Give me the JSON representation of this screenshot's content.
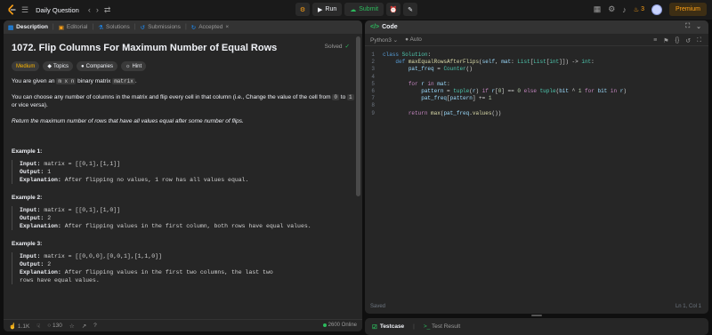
{
  "topbar": {
    "title": "Daily Question",
    "run": "Run",
    "submit": "Submit",
    "streak": "3",
    "premium": "Premium"
  },
  "left_tabs": [
    "Description",
    "Editorial",
    "Solutions",
    "Submissions",
    "Accepted"
  ],
  "problem": {
    "title": "1072. Flip Columns For Maximum Number of Equal Rows",
    "status": "Solved",
    "difficulty": "Medium",
    "pills": [
      "Topics",
      "Companies",
      "Hint"
    ],
    "intro_a": "You are given an ",
    "intro_code1": "m x n",
    "intro_b": " binary matrix ",
    "intro_code2": "matrix",
    "intro_c": ".",
    "p2_a": "You can choose any number of columns in the matrix and flip every cell in that column (i.e., Change the value of the cell from ",
    "p2_code1": "0",
    "p2_b": " to ",
    "p2_code2": "1",
    "p2_c": " or vice versa).",
    "p3": "Return the maximum number of rows that have all values equal after some number of flips.",
    "examples": [
      {
        "heading": "Example 1:",
        "input": "matrix = [[0,1],[1,1]]",
        "output": "1",
        "explanation": "After flipping no values, 1 row has all values equal."
      },
      {
        "heading": "Example 2:",
        "input": "matrix = [[0,1],[1,0]]",
        "output": "2",
        "explanation": "After flipping values in the first column, both rows have equal values."
      },
      {
        "heading": "Example 3:",
        "input": "matrix = [[0,0,0],[0,0,1],[1,1,0]]",
        "output": "2",
        "explanation": "After flipping values in the first two columns, the last two rows have equal values."
      }
    ],
    "labels": {
      "input": "Input:",
      "output": "Output:",
      "explanation": "Explanation:"
    }
  },
  "footer": {
    "likes": "1.1K",
    "comments": "130",
    "online": "2600 Online"
  },
  "code_panel": {
    "title": "Code",
    "language": "Python3",
    "mode": "Auto",
    "saved": "Saved",
    "cursor": "Ln 1, Col 1"
  },
  "code_lines": [
    "class Solution:",
    "    def maxEqualRowsAfterFlips(self, mat: List[List[int]]) -> int:",
    "        pat_freq = Counter()",
    "",
    "        for r in mat:",
    "            pattern = tuple(r) if r[0] == 0 else tuple(bit ^ 1 for bit in r)",
    "            pat_freq[pattern] += 1",
    "",
    "        return max(pat_freq.values())"
  ],
  "bottom_tabs": {
    "testcase": "Testcase",
    "result": "Test Result"
  }
}
